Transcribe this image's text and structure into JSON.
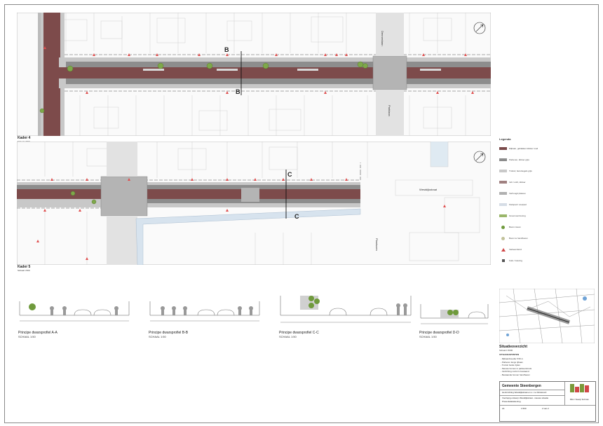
{
  "views": {
    "kader4": {
      "label": "Kader 4",
      "scale": "Schaal 1:500"
    },
    "kader5": {
      "label": "Kader 5",
      "scale": "Schaal 1:500"
    }
  },
  "section_marks": {
    "b": "B",
    "c": "C"
  },
  "street_names": [
    "Dennenlaan",
    "Parklaan",
    "Westdijkstraat",
    "Plantsoen"
  ],
  "profiles": [
    {
      "title": "Principe dwarsprofiel A-A",
      "scale": "SCHAAL 1:50"
    },
    {
      "title": "Principe dwarsprofiel B-B",
      "scale": "SCHAAL 1:50"
    },
    {
      "title": "Principe dwarsprofiel C-C",
      "scale": "SCHAAL 1:50"
    },
    {
      "title": "Principe dwarsprofiel D-D",
      "scale": "SCHAAL 1:50"
    }
  ],
  "legend": {
    "heading": "Legenda",
    "items": [
      {
        "label": "Rijbaan, gebakken klinker rood",
        "color": "#7a4a4a"
      },
      {
        "label": "Parkeren, klinker grijs",
        "color": "#8c8c8c"
      },
      {
        "label": "Trottoir, betontegels grijs",
        "color": "#c9c9c9"
      },
      {
        "label": "Inrit / uitrit, klinker",
        "color": "#a08080"
      },
      {
        "label": "Verhoogd plateau",
        "color": "#b0b0b0"
      },
      {
        "label": "Fietspad / voetpad",
        "color": "#d6dde6"
      },
      {
        "label": "Groenvoorziening",
        "color": "#9ab66a"
      },
      {
        "label": "Boom nieuw",
        "color": "#6f9a3c"
      },
      {
        "label": "Boom te handhaven",
        "color": "#c2c29a"
      },
      {
        "label": "Verkeersbord",
        "color": "#d04848"
      },
      {
        "label": "Kolk / riolering",
        "color": "#555555"
      }
    ]
  },
  "overview": {
    "title": "Situatieoverzicht",
    "scale": "Schaal 1:5000",
    "spec_heading": "UITGANGSPUNTEN",
    "notes": [
      "- Rijbaanbreedte 5.50 m",
      "- Parkeren langs rijbaan",
      "- Trottoir beide zijden",
      "- Nieuwe bomen in parkeerstrook",
      "- Verlichting conform bestaand",
      "- Bestaande bomen handhaven"
    ]
  },
  "title_block": {
    "client": "Gemeente Steenbergen",
    "project": "Herinrichting Westdijkstraat en o.i. te Dinteloord",
    "subtitle_1": "Voorlopig ontwerp Westdijkstraat - nieuwe situatie",
    "subtitle_2": "Presentatietekening",
    "firm": "B&G / Steady Techniek",
    "sheet_no": "2 van 2",
    "format": "A1",
    "scale": "1:500"
  }
}
